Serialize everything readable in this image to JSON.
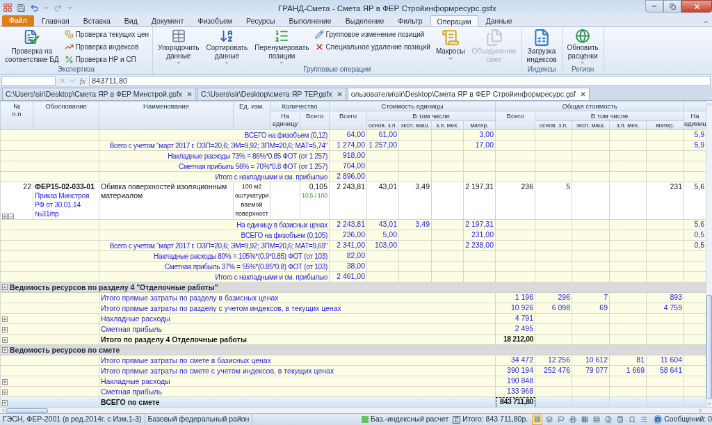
{
  "window": {
    "title": "ГРАНД-Смета - Смета ЯР в ФЕР Стройинформресурс.gsfx"
  },
  "ribbon": {
    "tabs": [
      {
        "label": "Файл",
        "kind": "file",
        "selected": false
      },
      {
        "label": "Главная",
        "kind": "tab",
        "selected": false
      },
      {
        "label": "Вставка",
        "kind": "tab",
        "selected": false
      },
      {
        "label": "Вид",
        "kind": "tab",
        "selected": false
      },
      {
        "label": "Документ",
        "kind": "tab",
        "selected": false
      },
      {
        "label": "Физобъем",
        "kind": "tab",
        "selected": false
      },
      {
        "label": "Ресурсы",
        "kind": "tab",
        "selected": false
      },
      {
        "label": "Выполнение",
        "kind": "tab",
        "selected": false
      },
      {
        "label": "Выделение",
        "kind": "tab",
        "selected": false
      },
      {
        "label": "Фильтр",
        "kind": "tab",
        "selected": false
      },
      {
        "label": "Операции",
        "kind": "tab",
        "selected": true
      },
      {
        "label": "Данные",
        "kind": "tab",
        "selected": false
      }
    ],
    "groups": [
      {
        "label": "Экспертиза",
        "items": [
          {
            "kind": "large",
            "label": "Проверка на\nсоответствие БД",
            "dropdown": false,
            "disabled": false
          },
          {
            "kind": "small",
            "label": "Проверка текущих цен"
          },
          {
            "kind": "small",
            "label": "Проверка индексов"
          },
          {
            "kind": "small",
            "label": "Проверка НР и СП"
          }
        ]
      },
      {
        "label": "Групповые операции",
        "items": [
          {
            "kind": "large",
            "label": "Упорядочить\nданные",
            "dropdown": true,
            "disabled": false
          },
          {
            "kind": "large",
            "label": "Сортировать\nданные",
            "dropdown": true,
            "disabled": false
          },
          {
            "kind": "large",
            "label": "Перенумеровать\nпозиции",
            "dropdown": true,
            "disabled": false
          },
          {
            "kind": "small",
            "label": "Групповое изменение позиций"
          },
          {
            "kind": "small",
            "label": "Специальное удаление позиций"
          },
          {
            "kind": "large",
            "label": "Макросы",
            "dropdown": true,
            "disabled": false
          },
          {
            "kind": "large",
            "label": "Объединение\nсмет",
            "dropdown": false,
            "disabled": true
          }
        ]
      },
      {
        "label": "Индексы",
        "items": [
          {
            "kind": "large",
            "label": "Загрузка\nиндексов",
            "dropdown": false,
            "disabled": false
          }
        ]
      },
      {
        "label": "Регион",
        "items": [
          {
            "kind": "large",
            "label": "Обновить\nрасценки",
            "dropdown": true,
            "disabled": false
          }
        ]
      }
    ]
  },
  "formula_bar": {
    "function_label": "fx",
    "value": "843711,80"
  },
  "documents": [
    {
      "label": "C:\\Users\\sir\\Desktop\\Смета ЯР в ФЕР Минстрой.gsfx",
      "selected": false
    },
    {
      "label": "C:\\Users\\sir\\Desktop\\смета ЯР ТЕР.gsfx",
      "selected": false
    },
    {
      "label": "ользователи\\sir\\Desktop\\Смета ЯР в ФЕР Стройинформресурс.gsf",
      "selected": true
    }
  ],
  "table": {
    "columns": [
      {
        "label": "№\nп.п"
      },
      {
        "label": "Обоснование"
      },
      {
        "label": "Наименование"
      },
      {
        "label": "Ед. изм."
      },
      {
        "label": "Количество",
        "children": [
          {
            "label": "На\nединицу"
          },
          {
            "label": "Всего"
          }
        ]
      },
      {
        "label": "Стоимость единицы",
        "children": [
          {
            "label": "Всего"
          },
          {
            "label": "В том числе",
            "children": [
              {
                "label": "основ. з.п."
              },
              {
                "label": "эксп. маш."
              },
              {
                "label": "з.п. мех."
              },
              {
                "label": "матер."
              }
            ]
          }
        ]
      },
      {
        "label": "Общая стоимость",
        "children": [
          {
            "label": "Всего"
          },
          {
            "label": "В том числе",
            "children": [
              {
                "label": "основ. з.п."
              },
              {
                "label": "эксп. маш."
              },
              {
                "label": "з.п. мех."
              },
              {
                "label": "матер."
              }
            ]
          }
        ]
      },
      {
        "children": [
          {
            "label": "На\nединиц"
          }
        ]
      }
    ],
    "rows": [
      {
        "kind": "summary",
        "label": "ВСЕГО на физобъем (0,12)",
        "values": {
          "unit_total": "64,00",
          "unit_wages": "61,00",
          "unit_materials": "3,00",
          "column_17": "5,9"
        },
        "expandable": false,
        "selected": false
      },
      {
        "kind": "summary",
        "label": "Всего с учетом \"март 2017 г. ОЗП=20,6; ЭМ=9,92; ЗПМ=20,6; МАТ=5,74\"",
        "values": {
          "unit_total": "1 274,00",
          "unit_wages": "1 257,00",
          "unit_materials": "17,00",
          "column_17": "5,9"
        },
        "expandable": false,
        "selected": false
      },
      {
        "kind": "summary",
        "label": "Накладные расходы 73% = 86%*0.85 ФОТ (от 1 257)",
        "values": {
          "unit_total": "918,00"
        },
        "expandable": false,
        "selected": false
      },
      {
        "kind": "summary",
        "label": "Сметная прибыль 56% = 70%*0.8 ФОТ (от 1 257)",
        "values": {
          "unit_total": "704,00"
        },
        "expandable": false,
        "selected": false
      },
      {
        "kind": "summary",
        "label": "Итого с накладными и см. прибылью",
        "values": {
          "unit_total": "2 896,00"
        },
        "expandable": false,
        "selected": false
      },
      {
        "kind": "position",
        "number": "22",
        "code": "ФЕР15-02-033-01",
        "reference": "Приказ Минстроя РФ от 30.01.14 №31/пр",
        "name": "Обивка поверхностей изоляционным материалом",
        "unit": "100 м2 оштукатури ваемой поверхност",
        "quantity": "0,105",
        "quantity_formula": "10,5 / 100",
        "values": {
          "unit_total": "2 243,81",
          "unit_wages": "43,01",
          "unit_machines": "3,49",
          "unit_materials": "2 197,31",
          "total": "236",
          "total_wages": "5",
          "total_materials": "231",
          "column_17": "5,6"
        },
        "expandable": true,
        "selected": false
      },
      {
        "kind": "summary",
        "label": "На единицу в базисных ценах",
        "values": {
          "unit_total": "2 243,81",
          "unit_wages": "43,01",
          "unit_machines": "3,49",
          "unit_materials": "2 197,31",
          "column_17": "5,6"
        },
        "expandable": false,
        "selected": false
      },
      {
        "kind": "summary",
        "label": "ВСЕГО на физобъем (0,105)",
        "values": {
          "unit_total": "236,00",
          "unit_wages": "5,00",
          "unit_materials": "231,00",
          "column_17": "0,5"
        },
        "expandable": false,
        "selected": false
      },
      {
        "kind": "summary",
        "label": "Всего с учетом \"март 2017 г. ОЗП=20,6; ЭМ=9,92; ЗПМ=20,6; МАТ=9,69\"",
        "values": {
          "unit_total": "2 341,00",
          "unit_wages": "103,00",
          "unit_materials": "2 238,00",
          "column_17": "0,5"
        },
        "expandable": false,
        "selected": false
      },
      {
        "kind": "summary",
        "label": "Накладные расходы 80% = 105%*(0.9*0.85) ФОТ (от 103)",
        "values": {
          "unit_total": "82,00"
        },
        "expandable": false,
        "selected": false
      },
      {
        "kind": "summary",
        "label": "Сметная прибыль 37% = 55%*(0.85*0.8) ФОТ (от 103)",
        "values": {
          "unit_total": "38,00"
        },
        "expandable": false,
        "selected": false
      },
      {
        "kind": "summary",
        "label": "Итого с накладными и см. прибылью",
        "values": {
          "unit_total": "2 461,00"
        },
        "expandable": false,
        "selected": false
      },
      {
        "kind": "group",
        "label": "Ведомость ресурсов по разделу 4 \"Отделочные работы\"",
        "expandable": true,
        "selected": false
      },
      {
        "kind": "line",
        "label": "Итого прямые затраты по разделу в базисных ценах",
        "values": {
          "total": "1 196",
          "total_wages": "296",
          "total_machines": "7",
          "total_materials": "893"
        },
        "expandable": false,
        "selected": false
      },
      {
        "kind": "line",
        "label": "Итого прямые затраты по разделу с учетом индексов, в текущих ценах",
        "values": {
          "total": "10 926",
          "total_wages": "6 098",
          "total_machines": "69",
          "total_materials": "4 759"
        },
        "expandable": false,
        "selected": false
      },
      {
        "kind": "line",
        "label": "Накладные расходы",
        "values": {
          "total": "4 791"
        },
        "expandable": true,
        "selected": false
      },
      {
        "kind": "line",
        "label": "Сметная прибыль",
        "values": {
          "total": "2 495"
        },
        "expandable": true,
        "selected": false
      },
      {
        "kind": "total",
        "label": "Итого по разделу 4 Отделочные работы",
        "values": {
          "total": "18 212,00"
        },
        "expandable": true,
        "selected": false
      },
      {
        "kind": "group",
        "label": "Ведомость ресурсов по смете",
        "expandable": true,
        "selected": false
      },
      {
        "kind": "line",
        "label": "Итого прямые затраты по смете в базисных ценах",
        "values": {
          "total": "34 472",
          "total_wages": "12 256",
          "total_machines": "10 612",
          "total_mech_wages": "81",
          "total_materials": "11 604"
        },
        "expandable": false,
        "selected": false
      },
      {
        "kind": "line",
        "label": "Итого прямые затраты по смете с учетом индексов, в текущих ценах",
        "values": {
          "total": "390 194",
          "total_wages": "252 476",
          "total_machines": "79 077",
          "total_mech_wages": "1 669",
          "total_materials": "58 641"
        },
        "expandable": false,
        "selected": false
      },
      {
        "kind": "line",
        "label": "Накладные расходы",
        "values": {
          "total": "190 848"
        },
        "expandable": true,
        "selected": false
      },
      {
        "kind": "line",
        "label": "Сметная прибыль",
        "values": {
          "total": "133 968"
        },
        "expandable": true,
        "selected": false
      },
      {
        "kind": "total",
        "label": "ВСЕГО по смете",
        "values": {
          "total": "843 711,80"
        },
        "expandable": true,
        "selected": true
      }
    ]
  },
  "status_bar": {
    "norms": "ГЭСН, ФЕР-2001 (в ред.2014г. с Изм.1-3)",
    "region": "Базовый федеральный район",
    "mode": "Баз.-индексный расчет",
    "total": "Итого: 843 711,80р.",
    "view_buttons": [
      {
        "selected": true
      },
      {
        "selected": false
      },
      {
        "selected": false
      },
      {
        "selected": false
      },
      {
        "selected": false
      },
      {
        "selected": false
      },
      {
        "selected": false
      },
      {
        "selected": false
      },
      {
        "selected": false
      },
      {
        "selected": false
      }
    ],
    "messages": "Сообщений: 0"
  }
}
